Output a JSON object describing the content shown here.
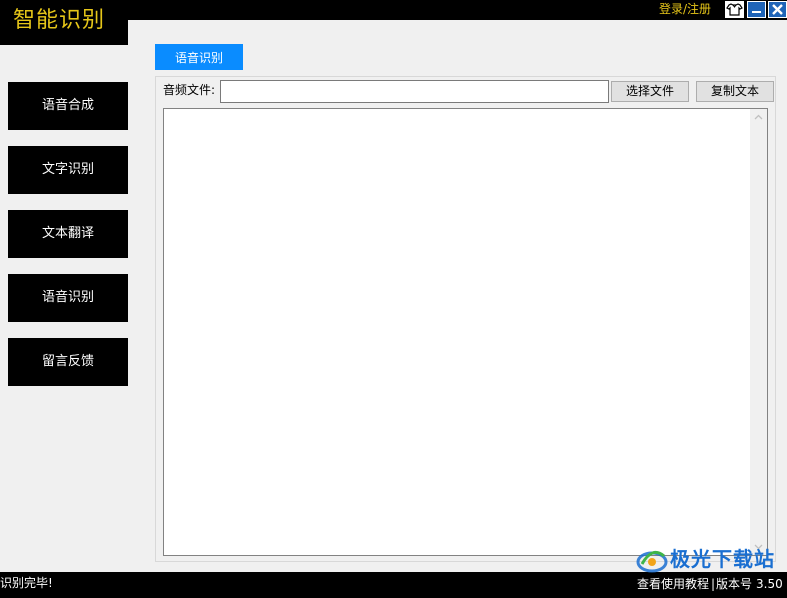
{
  "app": {
    "title": "智能识别"
  },
  "header": {
    "login": "登录/注册"
  },
  "sidebar": {
    "items": [
      {
        "label": "语音合成"
      },
      {
        "label": "文字识别"
      },
      {
        "label": "文本翻译"
      },
      {
        "label": "语音识别"
      },
      {
        "label": "留言反馈"
      }
    ]
  },
  "tab": {
    "label": "语音识别"
  },
  "form": {
    "file_label": "音频文件:",
    "file_value": "",
    "choose_button": "选择文件",
    "copy_button": "复制文本"
  },
  "status": {
    "message": "识别完毕!",
    "tutorial": "查看使用教程",
    "separator": "|",
    "version_label": "版本号",
    "version_value": "3.50"
  },
  "watermark": {
    "text": "极光下载站"
  },
  "colors": {
    "accent": "#0a8cff",
    "title": "#e6c619",
    "window_button": "#1f64b8"
  },
  "icons": {
    "skin": "shirt-icon",
    "minimize": "minimize-icon",
    "close": "close-icon"
  }
}
